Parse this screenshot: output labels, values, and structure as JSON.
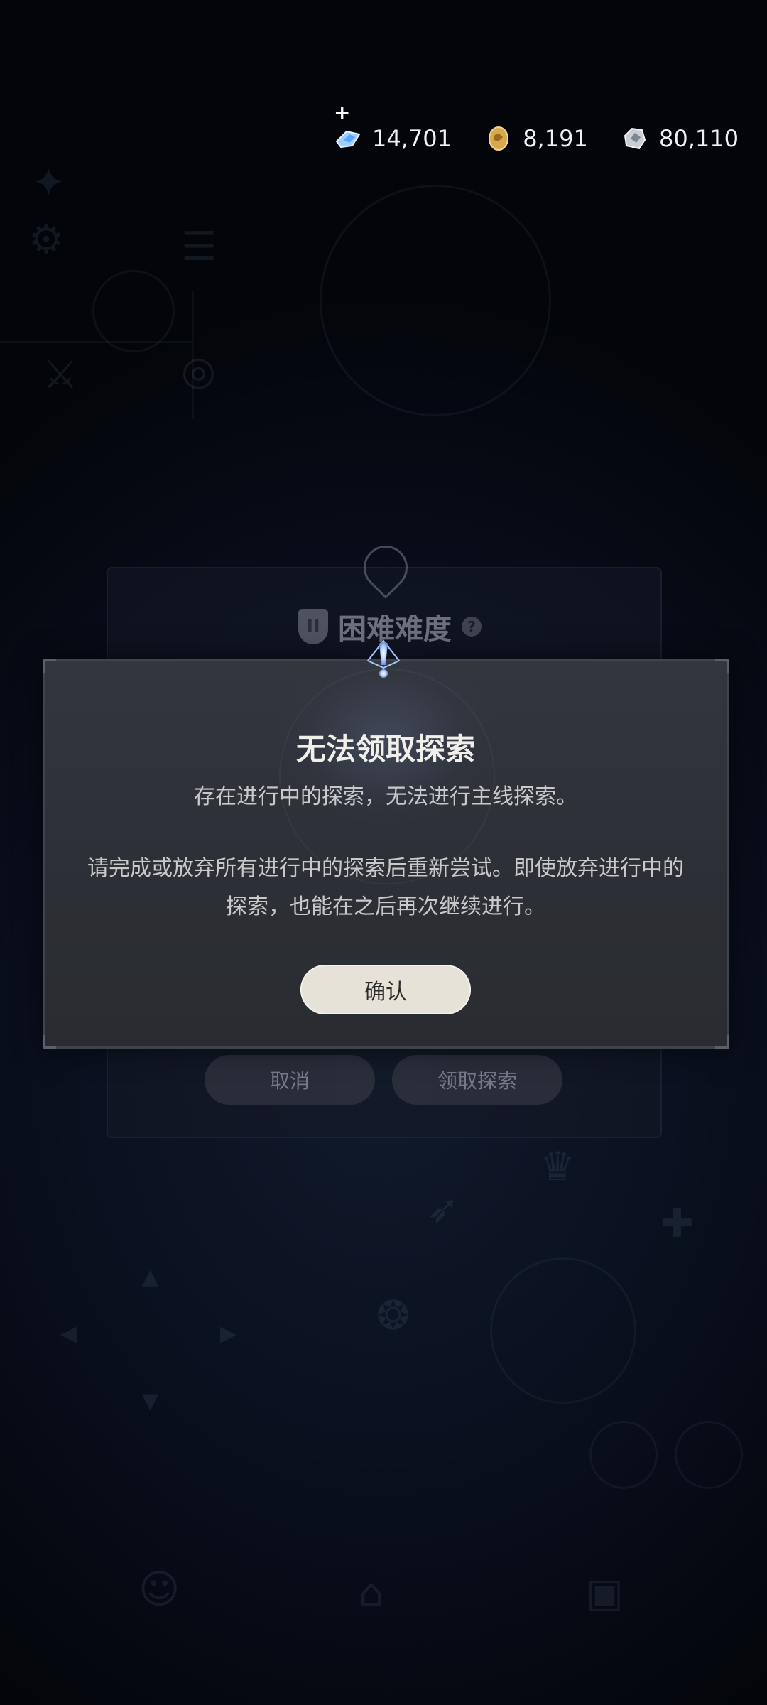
{
  "currency": {
    "plus_label": "+",
    "items": [
      {
        "icon": "blue-crystal-icon",
        "value": "14,701",
        "color": "#8fc3ff"
      },
      {
        "icon": "gold-coin-icon",
        "value": "8,191",
        "color": "#d8a94a"
      },
      {
        "icon": "silver-ore-icon",
        "value": "80,110",
        "color": "#c9ced6"
      }
    ]
  },
  "background_panel": {
    "title": "困难难度",
    "badge": "II",
    "help": "?",
    "cancel_label": "取消",
    "claim_label": "领取探索"
  },
  "modal": {
    "title": "无法领取探索",
    "line1": "存在进行中的探索，无法进行主线探索。",
    "line2": "请完成或放弃所有进行中的探索后重新尝试。即使放弃进行中的探索，也能在之后再次继续进行。",
    "confirm_label": "确认"
  },
  "colors": {
    "modal_bg": "#2f3238",
    "confirm_bg": "#e6e2d8",
    "accent_blue": "#a8c4ff"
  }
}
